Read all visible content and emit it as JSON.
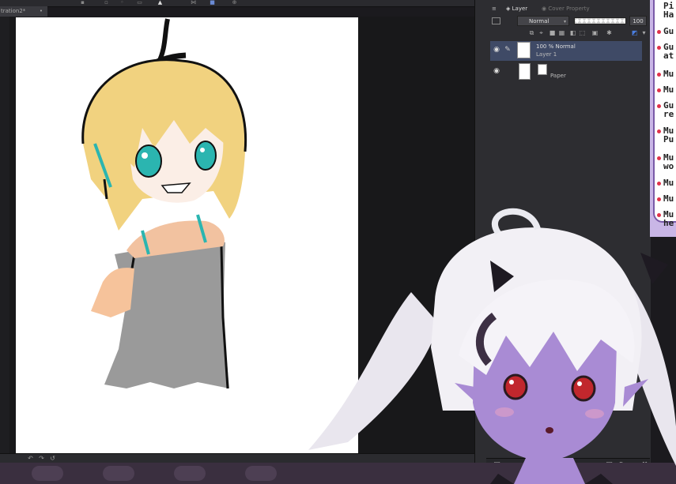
{
  "document": {
    "tab_title": "tration2*",
    "tab_close": "•"
  },
  "toolbar": {
    "icons": [
      "brush-icon",
      "eraser-icon",
      "move-icon",
      "select-icon",
      "cursor-icon",
      "transform-icon",
      "fill-icon",
      "layer-icon"
    ]
  },
  "panel": {
    "tab_layer": "Layer",
    "tab_cover": "Cover Property",
    "blend_mode": "Normal",
    "opacity_value": "100",
    "layers": [
      {
        "name_line1": "100 % Normal",
        "name_line2": "Layer 1",
        "selected": true
      },
      {
        "name_line1": "",
        "name_line2": "Paper",
        "selected": false
      }
    ]
  },
  "chat": {
    "messages": [
      {
        "text": "Pi\nHa"
      },
      {
        "text": "Gu"
      },
      {
        "text": "Gu\nat"
      },
      {
        "text": "Mu"
      },
      {
        "text": "Mu"
      },
      {
        "text": "Gu\nre"
      },
      {
        "text": "Mu\nPu"
      },
      {
        "text": "Mu\nwo"
      },
      {
        "text": "Mu"
      },
      {
        "text": "Mu"
      },
      {
        "text": "Mu\nhe"
      }
    ]
  },
  "colors": {
    "accent": "#3f4a66",
    "chat_border": "#7a5aa8",
    "chat_bg": "#c9b6e6",
    "avatar_skin": "#a98bd4",
    "hair_blonde": "#f1d27f",
    "eyes_teal": "#2bb5b0",
    "dress_gray": "#9a9a9a"
  }
}
